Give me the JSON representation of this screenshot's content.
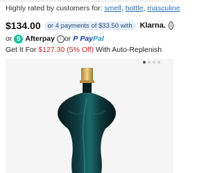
{
  "rating": {
    "prefix": "Highly rated by customers for:",
    "tags": [
      "smell",
      "bottle",
      "masculine"
    ]
  },
  "price": {
    "amount": "$134.00",
    "installments": "or 4 payments of $33.50 with",
    "provider": "Klarna."
  },
  "alt_payments": {
    "or1": "or",
    "afterpay_icon": "S",
    "afterpay": "Afterpay",
    "or2": "or",
    "paypal_p": "P",
    "paypal_pay": "Pay",
    "paypal_pal": "Pal"
  },
  "replenish": {
    "prefix": "Get It For",
    "discount": "$127.30 (5% Off)",
    "suffix": "With Auto-Replenish"
  },
  "carousel": {
    "current_slide": 1,
    "slide_count": 4
  },
  "colors": {
    "link": "#2a6fb8",
    "discount": "#cc1f1f",
    "bottle_glass": "#0f3b3f",
    "cap": "#d9b56a"
  }
}
